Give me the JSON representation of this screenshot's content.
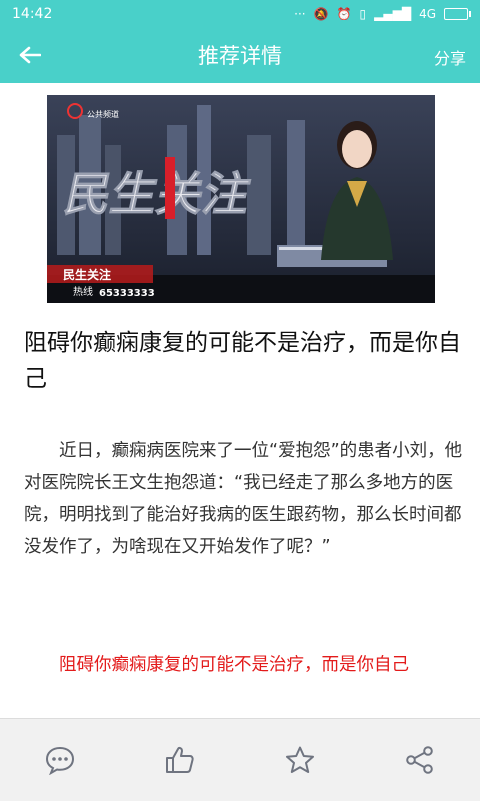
{
  "status_bar": {
    "time": "14:42",
    "icons_text": "4G",
    "icons": [
      "more-dots-icon",
      "mute-icon",
      "alarm-icon",
      "vibrate-icon",
      "signal-icon",
      "battery-icon"
    ]
  },
  "header": {
    "title": "推荐详情",
    "share_label": "分享"
  },
  "hero": {
    "show_name": "民生关注",
    "small_logo_text": "公共频道",
    "hotline_label": "热线",
    "hotline_number": "65333333",
    "ticker_text": "民生关注"
  },
  "article": {
    "headline": "阻碍你癫痫康复的可能不是治疗，而是你自己",
    "paragraph": "近日，癫痫病医院来了一位“爱抱怨”的患者小刘，他对医院院长王文生抱怨道：“我已经走了那么多地方的医院，明明找到了能治好我病的医生跟药物，那么长时间都没发作了，为啥现在又开始发作了呢？”",
    "subheading": "阻碍你癫痫康复的可能不是治疗，而是你自己"
  },
  "colors": {
    "accent": "#49d0c9",
    "fab": "#f77b1f",
    "red_text": "#e31b1b"
  }
}
